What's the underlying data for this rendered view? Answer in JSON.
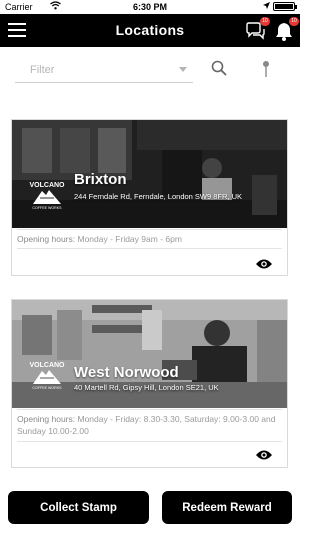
{
  "status_bar": {
    "carrier": "Carrier",
    "wifi_icon": "wifi-icon",
    "time": "6:30 PM",
    "battery_icon": "battery-icon",
    "location_icon": "location-arrow-icon"
  },
  "nav": {
    "title": "Locations",
    "menu_icon": "hamburger-menu-icon",
    "chat_icon": "chat-bubbles-icon",
    "chat_badge": "10",
    "bell_icon": "bell-icon",
    "bell_badge": "10"
  },
  "filter": {
    "placeholder": "Filter",
    "search_icon": "search-icon",
    "pin_icon": "map-pin-icon"
  },
  "locations": [
    {
      "name": "Brixton",
      "address": "244 Ferndale Rd, Ferndale, London SW9 8FR, UK",
      "hours_label": "Opening hours:",
      "hours_value": "Monday - Friday 9am - 6pm",
      "logo_text": "VOLCANO",
      "logo_sub": "COFFEE WORKS"
    },
    {
      "name": "West Norwood",
      "address": "40 Martell Rd, Gipsy Hill, London SE21, UK",
      "hours_label": "Opening hours:",
      "hours_value": "Monday - Friday: 8.30-3.30, Saturday: 9.00-3.00 and Sunday 10.00-2.00",
      "logo_text": "VOLCANO",
      "logo_sub": "COFFEE WORKS"
    }
  ],
  "buttons": {
    "collect": "Collect Stamp",
    "redeem": "Redeem Reward"
  },
  "colors": {
    "nav_bg": "#000000",
    "button_bg": "#000000",
    "badge": "#e53935"
  }
}
